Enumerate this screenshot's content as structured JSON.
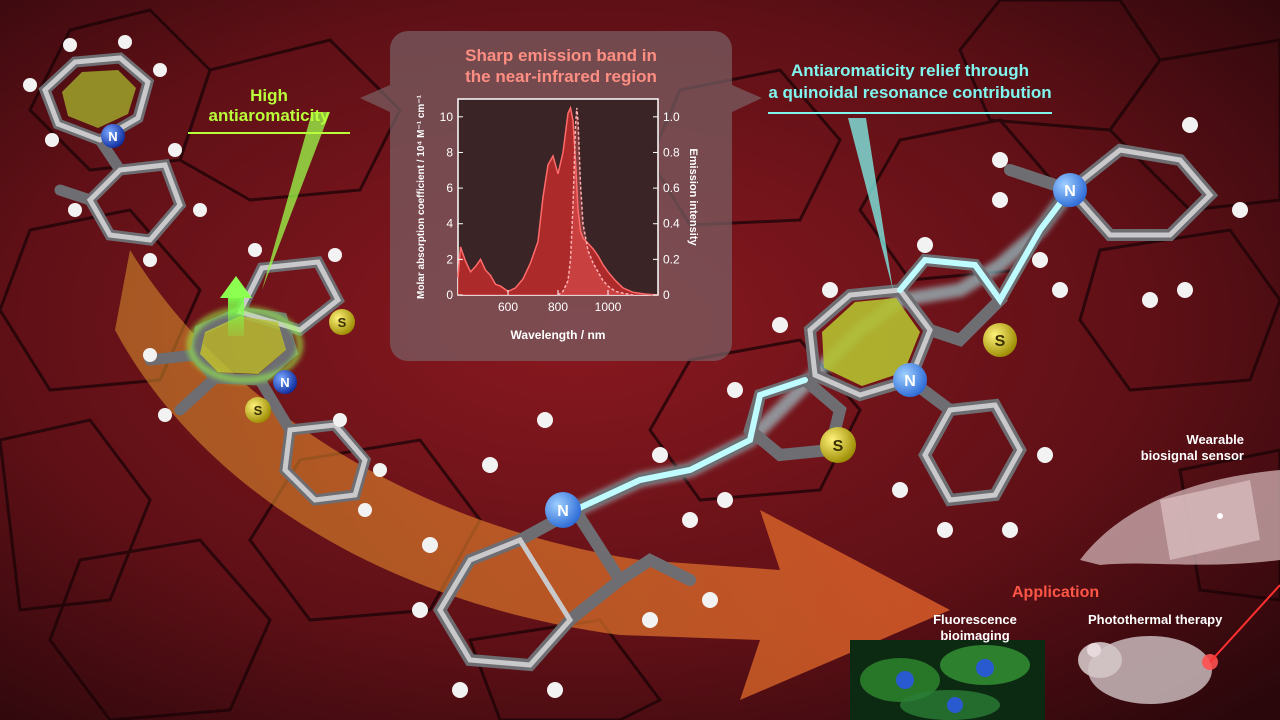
{
  "labels": {
    "high_antiaromaticity": "High antiaromaticity",
    "relief_line1": "Antiaromaticity relief through",
    "relief_line2": "a quinoidal resonance contribution",
    "application": "Application",
    "fluorescence_line1": "Fluorescence",
    "fluorescence_line2": "bioimaging",
    "photothermal": "Photothermal therapy",
    "wearable_line1": "Wearable",
    "wearable_line2": "biosignal sensor"
  },
  "atoms": {
    "n": "N",
    "s": "S"
  },
  "chart_data": {
    "type": "area",
    "title_line1": "Sharp emission band in",
    "title_line2": "the near-infrared region",
    "xlabel": "Wavelength / nm",
    "ylabel_left": "Molar absorption coefficient / 10⁴ M⁻¹ cm⁻¹",
    "ylabel_right": "Emission intensity",
    "xlim": [
      400,
      1200
    ],
    "ylim_left": [
      0,
      11
    ],
    "ylim_right": [
      0,
      1.1
    ],
    "x_ticks": [
      "600",
      "800",
      "1000"
    ],
    "x_tick_values": [
      600,
      800,
      1000
    ],
    "y_left_ticks": [
      "0",
      "2",
      "4",
      "6",
      "8",
      "10"
    ],
    "y_left_tick_values": [
      0,
      2,
      4,
      6,
      8,
      10
    ],
    "y_right_ticks": [
      "0",
      "0.2",
      "0.4",
      "0.6",
      "0.8",
      "1.0"
    ],
    "y_right_tick_values": [
      0,
      0.2,
      0.4,
      0.6,
      0.8,
      1.0
    ],
    "series": [
      {
        "role": "absorption",
        "axis": "left",
        "x": [
          400,
          410,
          430,
          450,
          470,
          490,
          510,
          530,
          550,
          570,
          600,
          630,
          660,
          690,
          720,
          740,
          760,
          780,
          800,
          820,
          840,
          850,
          860,
          870,
          880,
          890,
          900,
          920,
          940,
          960,
          980,
          1000,
          1030,
          1060,
          1100,
          1150,
          1200
        ],
        "y": [
          1.0,
          2.7,
          1.9,
          1.3,
          1.6,
          2.0,
          1.4,
          1.1,
          0.6,
          0.5,
          0.2,
          0.4,
          0.9,
          1.8,
          3.0,
          5.5,
          7.3,
          7.8,
          6.8,
          8.0,
          10.2,
          10.5,
          9.8,
          7.5,
          4.8,
          3.6,
          3.2,
          2.9,
          2.6,
          2.2,
          1.7,
          1.3,
          0.8,
          0.4,
          0.15,
          0.05,
          0
        ],
        "color": "#c22c2c"
      },
      {
        "role": "emission",
        "axis": "right",
        "x": [
          800,
          820,
          840,
          850,
          860,
          870,
          875,
          880,
          890,
          900,
          920,
          940,
          960,
          980,
          1000,
          1030,
          1060,
          1100
        ],
        "y": [
          0,
          0.02,
          0.08,
          0.2,
          0.5,
          0.95,
          1.05,
          0.98,
          0.62,
          0.4,
          0.25,
          0.18,
          0.13,
          0.08,
          0.05,
          0.02,
          0.01,
          0
        ],
        "color": "#ff6a6a"
      }
    ]
  }
}
